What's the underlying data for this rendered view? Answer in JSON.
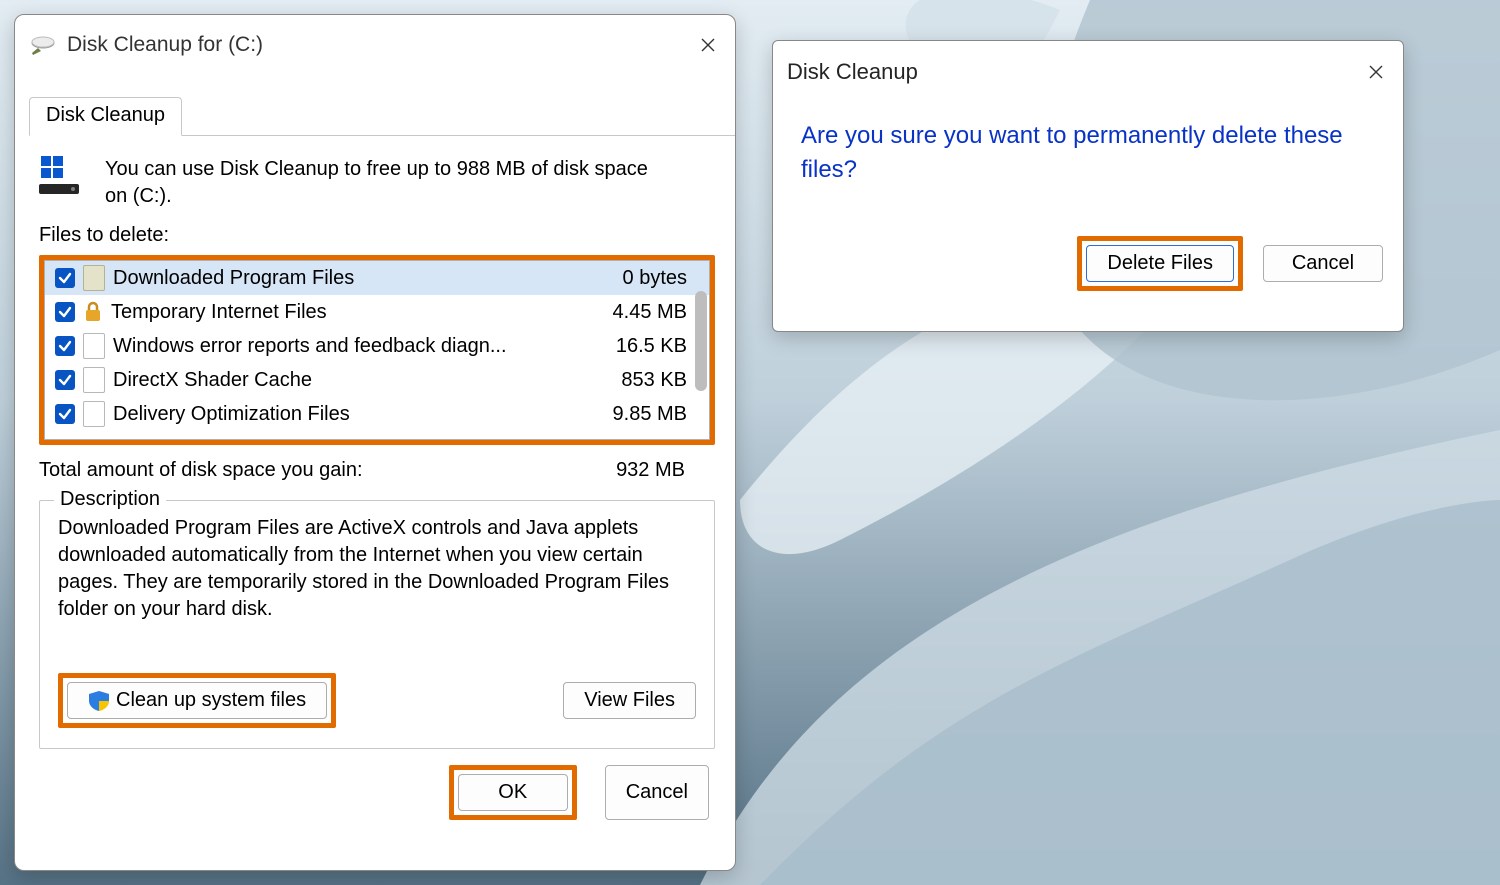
{
  "main": {
    "title": "Disk Cleanup for  (C:)",
    "tab_label": "Disk Cleanup",
    "intro": "You can use Disk Cleanup to free up to 988 MB of disk space on (C:).",
    "files_to_delete_label": "Files to delete:",
    "files": [
      {
        "name": "Downloaded Program Files",
        "size": "0 bytes",
        "icon": "folder",
        "selected": true
      },
      {
        "name": "Temporary Internet Files",
        "size": "4.45 MB",
        "icon": "lock",
        "selected": false
      },
      {
        "name": "Windows error reports and feedback diagn...",
        "size": "16.5 KB",
        "icon": "file",
        "selected": false
      },
      {
        "name": "DirectX Shader Cache",
        "size": "853 KB",
        "icon": "file",
        "selected": false
      },
      {
        "name": "Delivery Optimization Files",
        "size": "9.85 MB",
        "icon": "file",
        "selected": false
      }
    ],
    "total_label": "Total amount of disk space you gain:",
    "total_value": "932 MB",
    "description_legend": "Description",
    "description_text": "Downloaded Program Files are ActiveX controls and Java applets downloaded automatically from the Internet when you view certain pages. They are temporarily stored in the Downloaded Program Files folder on your hard disk.",
    "buttons": {
      "clean_system": "Clean up system files",
      "view_files": "View Files",
      "ok": "OK",
      "cancel": "Cancel"
    }
  },
  "confirm": {
    "title": "Disk Cleanup",
    "question": "Are you sure you want to permanently delete these files?",
    "buttons": {
      "delete": "Delete Files",
      "cancel": "Cancel"
    }
  }
}
